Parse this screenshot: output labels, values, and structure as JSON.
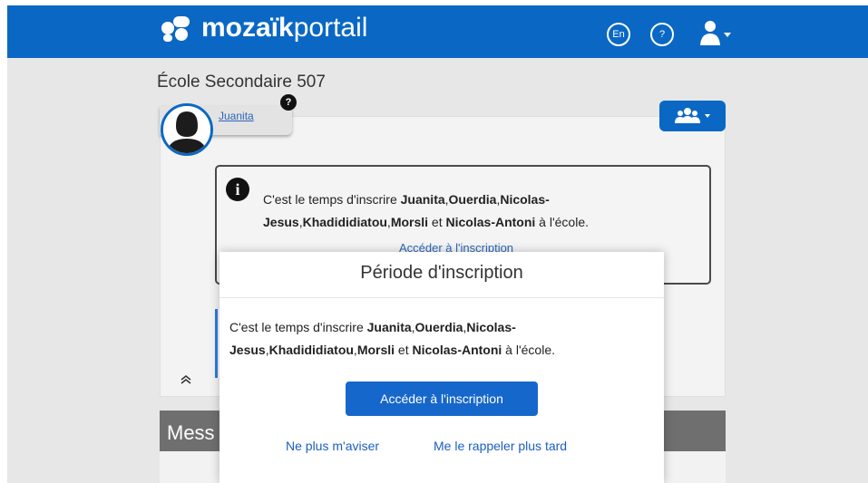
{
  "header": {
    "logo_bold": "mozaïk",
    "logo_light": "portail",
    "lang_button": "En",
    "help_button": "?"
  },
  "school": {
    "name": "École Secondaire 507"
  },
  "student": {
    "name": "Juanita",
    "help_badge": "?"
  },
  "notice": {
    "icon": "i",
    "prefix": "C'est le temps d'inscrire ",
    "names": [
      "Juanita",
      "Ouerdia",
      "Nicolas-Jesus",
      "Khadididiatou",
      "Morsli",
      "Nicolas-Antoni"
    ],
    "and": " et ",
    "suffix": " à l'école.",
    "link": "Accéder à l'inscription"
  },
  "messages": {
    "label": "Mess"
  },
  "modal": {
    "title": "Période d'inscription",
    "prefix": "C'est le temps d'inscrire ",
    "and": " et ",
    "suffix": " à l'école.",
    "primary_button": "Accéder à l'inscription",
    "dismiss_link": "Ne plus m'aviser",
    "remind_link": "Me le rappeler plus tard"
  },
  "colors": {
    "brand_blue": "#0a68c4",
    "link_blue": "#1a5fbf"
  }
}
